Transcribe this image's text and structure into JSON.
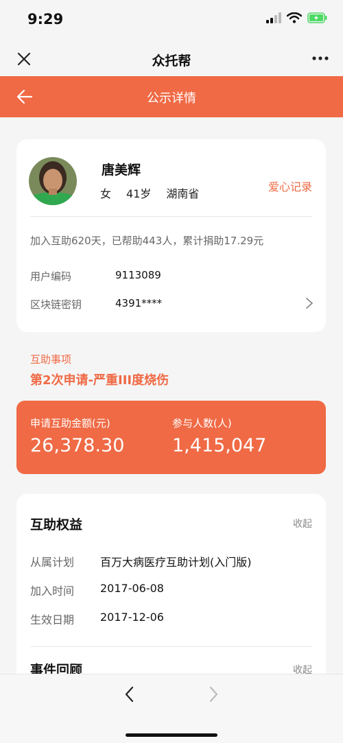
{
  "status": {
    "time": "9:29"
  },
  "app": {
    "title": "众托帮"
  },
  "nav": {
    "title": "公示详情"
  },
  "profile": {
    "name": "唐美辉",
    "gender": "女",
    "age": "41岁",
    "province": "湖南省",
    "love_link": "爱心记录",
    "summary": "加入互助620天，已帮助443人，累计捐助17.29元",
    "user_id_label": "用户编码",
    "user_id_value": "9113089",
    "blockchain_label": "区块链密钥",
    "blockchain_value": "4391****"
  },
  "mutual": {
    "section_label": "互助事项",
    "title": "第2次申请-严重III度烧伤"
  },
  "stats": {
    "amount_label": "申请互助金额(元)",
    "amount_value": "26,378.30",
    "participants_label": "参与人数(人)",
    "participants_value": "1,415,047"
  },
  "rights": {
    "title": "互助权益",
    "collapse": "收起",
    "plan_label": "从属计划",
    "plan_value": "百万大病医疗互助计划(入门版)",
    "join_label": "加入时间",
    "join_value": "2017-06-08",
    "effective_label": "生效日期",
    "effective_value": "2017-12-06"
  },
  "events": {
    "title": "事件回顾",
    "collapse": "收起"
  },
  "colors": {
    "accent": "#ef6a45",
    "battery": "#4cd964"
  },
  "icons": [
    "signal-icon",
    "wifi-icon",
    "battery-icon",
    "close-icon",
    "more-icon",
    "back-arrow-icon",
    "chevron-right-icon",
    "chevron-left-icon",
    "avatar"
  ]
}
